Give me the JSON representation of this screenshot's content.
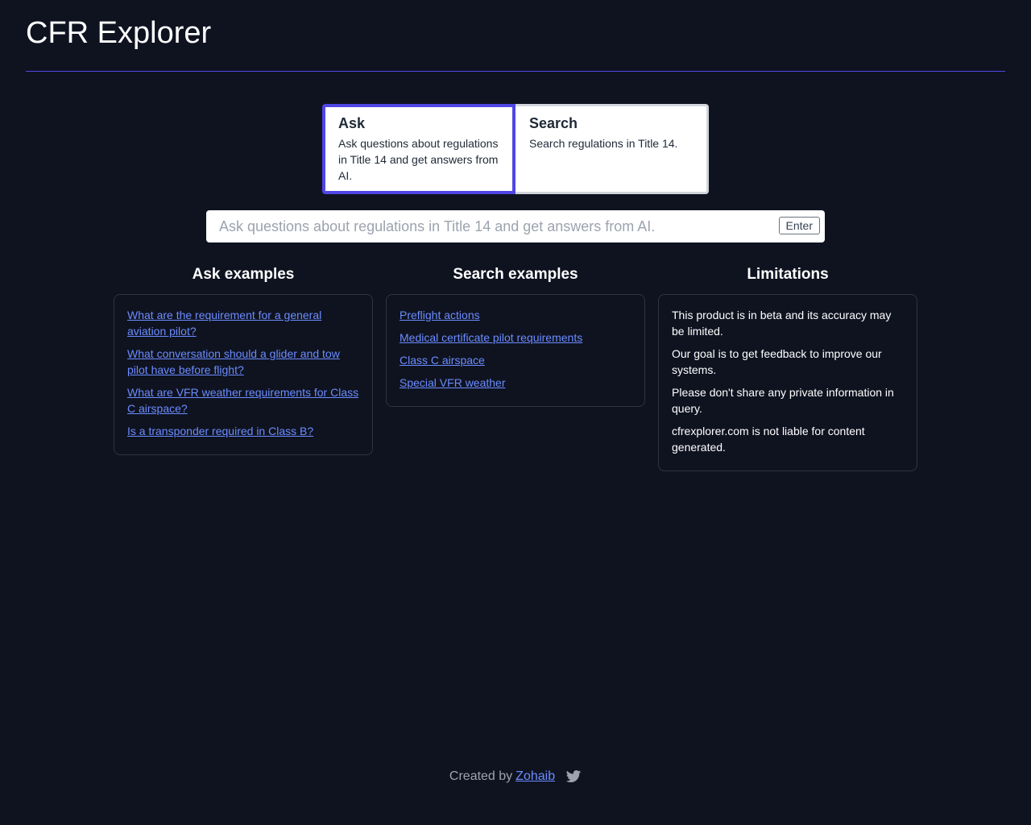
{
  "app": {
    "title": "CFR Explorer"
  },
  "modes": {
    "ask": {
      "title": "Ask",
      "description": "Ask questions about regulations in Title 14 and get answers from AI."
    },
    "search": {
      "title": "Search",
      "description": "Search regulations in Title 14."
    }
  },
  "query": {
    "placeholder": "Ask questions about regulations in Title 14 and get answers from AI.",
    "value": "",
    "enter_label": "Enter"
  },
  "ask_examples": {
    "heading": "Ask examples",
    "items": [
      "What are the requirement for a general aviation pilot?",
      "What conversation should a glider and tow pilot have before flight?",
      "What are VFR weather requirements for Class C airspace?",
      "Is a transponder required in Class B?"
    ]
  },
  "search_examples": {
    "heading": "Search examples",
    "items": [
      "Preflight actions",
      "Medical certificate pilot requirements",
      "Class C airspace",
      "Special VFR weather"
    ]
  },
  "limitations": {
    "heading": "Limitations",
    "items": [
      "This product is in beta and its accuracy may be limited.",
      "Our goal is to get feedback to improve our systems.",
      "Please don't share any private information in query.",
      "cfrexplorer.com is not liable for content generated."
    ]
  },
  "footer": {
    "prefix": "Created by",
    "author": "Zohaib",
    "social_icon": "twitter-icon"
  },
  "colors": {
    "background": "#0f1320",
    "accent": "#4f46e5",
    "link": "#6b8cff"
  }
}
